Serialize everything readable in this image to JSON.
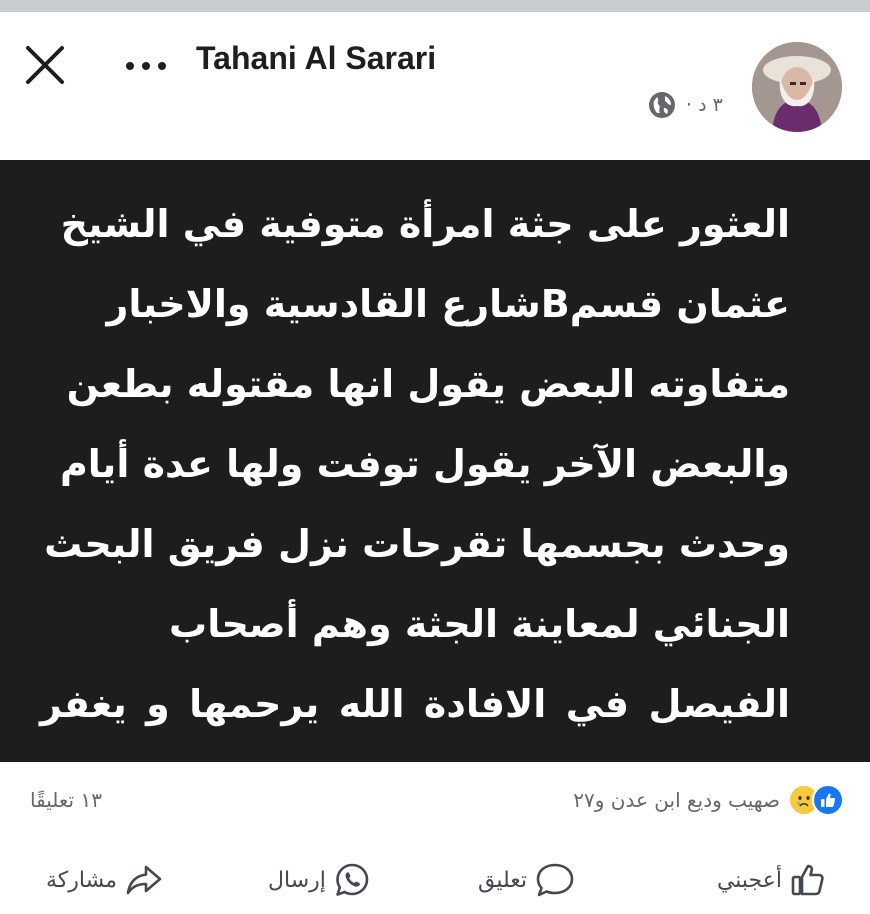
{
  "post": {
    "author": "Tahani Al Sarari",
    "time": "٣ د ·",
    "body": "العثور على جثة امرأة متوفية في الشيخ\nعثمان قسمBشارع القادسية والاخبار\nمتفاوته البعض يقول  انها مقتوله بطعن\nوالبعض الآخر يقول توفت ولها عدة أيام\nوحدث بجسمها تقرحات نزل فريق البحث\nالجنائي لمعاينة الجثة وهم أصحاب\nالفيصل في الافادة الله يرحمها و يغفر لها"
  },
  "stats": {
    "reaction_names": "صهيب وديع ابن عدن و٢٧",
    "comment_count": "١٣ تعليقًا"
  },
  "actions": {
    "like": "أعجبني",
    "comment": "تعليق",
    "send": "إرسال",
    "share": "مشاركة"
  },
  "icons": {
    "close": "close-icon",
    "more": "more-icon",
    "globe": "globe-icon",
    "like_reaction": "like-reaction-icon",
    "sad_reaction": "sad-reaction-icon",
    "like": "thumbs-up-icon",
    "comment": "comment-bubble-icon",
    "send": "whatsapp-icon",
    "share": "share-arrow-icon"
  },
  "colors": {
    "image_background": "#1d1d1d",
    "like_blue": "#1877f2",
    "sad_yellow": "#f7c93e",
    "secondary_text": "#65676b"
  }
}
